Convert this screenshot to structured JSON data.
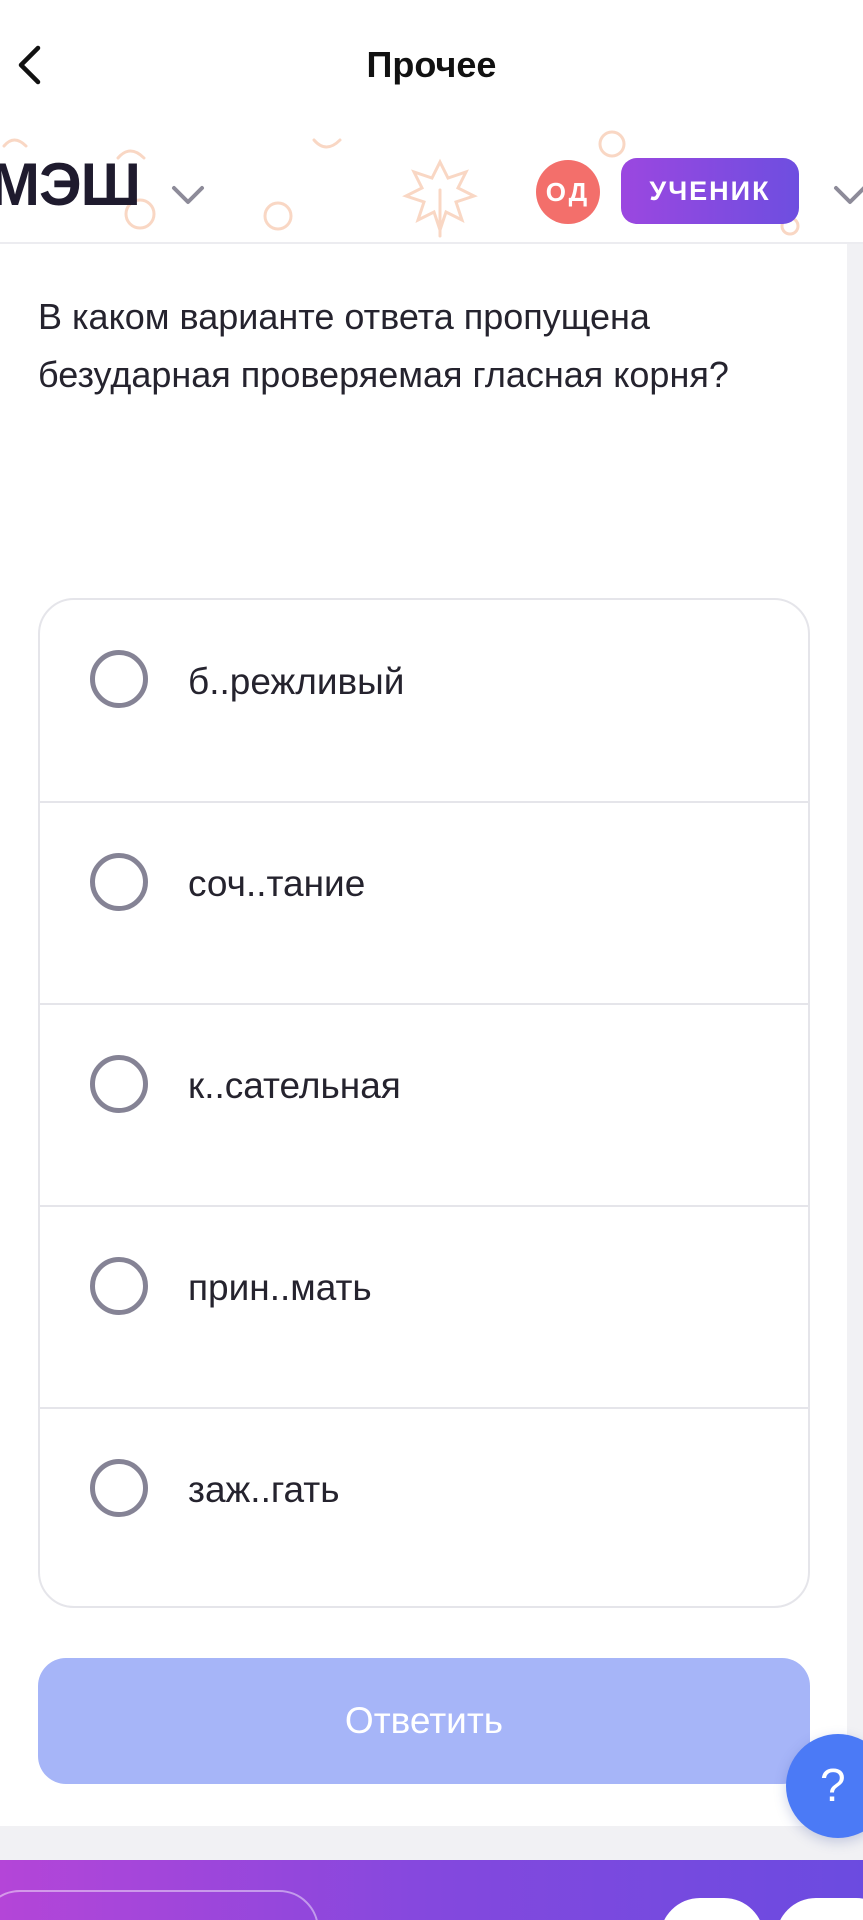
{
  "header": {
    "title": "Прочее"
  },
  "brand": {
    "logo_text": "МЭШ",
    "avatar_initials": "ОД",
    "role_label": "УЧЕНИК"
  },
  "question": {
    "text": "В каком варианте ответа пропущена безударная проверяемая гласная корня?"
  },
  "options": [
    {
      "label": "б..режливый"
    },
    {
      "label": "соч..тание"
    },
    {
      "label": "к..сательная"
    },
    {
      "label": "прин..мать"
    },
    {
      "label": "заж..гать"
    }
  ],
  "submit": {
    "label": "Ответить"
  },
  "help": {
    "label": "?"
  },
  "colors": {
    "accent_purple": "#9b47e0",
    "accent_violet": "#6e4ee0",
    "avatar_red": "#f36f6b",
    "submit_disabled": "#a6b5f8",
    "help_blue": "#4b7af6",
    "decor_orange": "#f9d7c4"
  }
}
